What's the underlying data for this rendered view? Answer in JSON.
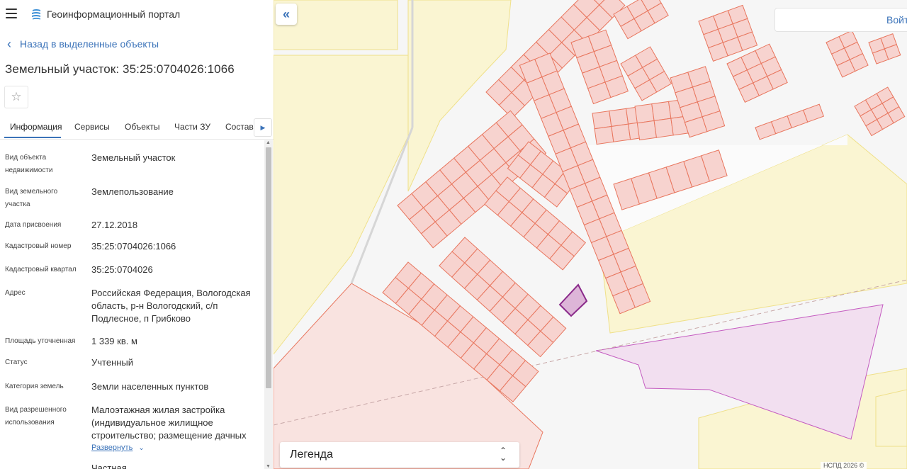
{
  "app": {
    "title": "Геоинформационный портал",
    "menu_icon": "hamburger-menu-icon",
    "logo_icon": "geoportal-logo-icon"
  },
  "nav": {
    "back_label": "Назад в выделенные объекты"
  },
  "object": {
    "title": "Земельный участок: 35:25:0704026:1066"
  },
  "tabs": [
    {
      "label": "Информация",
      "active": true
    },
    {
      "label": "Сервисы"
    },
    {
      "label": "Объекты"
    },
    {
      "label": "Части ЗУ"
    },
    {
      "label": "Состав"
    }
  ],
  "info_rows": [
    {
      "label": "Вид объекта недвижимости",
      "value": "Земельный участок"
    },
    {
      "label": "Вид земельного участка",
      "value": "Землепользование"
    },
    {
      "label": "Дата присвоения",
      "value": "27.12.2018"
    },
    {
      "label": "Кадастровый номер",
      "value": "35:25:0704026:1066"
    },
    {
      "label": "Кадастровый квартал",
      "value": "35:25:0704026"
    },
    {
      "label": "Адрес",
      "value": "Российская Федерация, Вологодская область, р-н Вологодский, с/п Подлесное, п Грибково"
    },
    {
      "label": "Площадь уточненная",
      "value": "1 339 кв. м"
    },
    {
      "label": "Статус",
      "value": "Учтенный"
    },
    {
      "label": "Категория земель",
      "value": "Земли населенных пунктов"
    },
    {
      "label": "Вид разрешенного использования",
      "value": "Малоэтажная жилая застройка (индивидуальное жилищное строительство; размещение дачных"
    },
    {
      "label": "",
      "value": "Частная"
    }
  ],
  "expand_label": "Развернуть",
  "map": {
    "login_label": "Войти",
    "legend_label": "Легенда",
    "attribution": "НСПД 2026 ©",
    "colors": {
      "parcel_fill": "#f7d3cf",
      "parcel_stroke": "#e8765e",
      "zone_yellow": "#faf5d2",
      "zone_yellow_stroke": "#efe08a",
      "zone_purple": "#f2dff0",
      "zone_purple_stroke": "#c45bc0",
      "selected_fill": "#ddb5d8",
      "selected_stroke": "#8a2a8a",
      "accent": "#3b73b9"
    }
  }
}
